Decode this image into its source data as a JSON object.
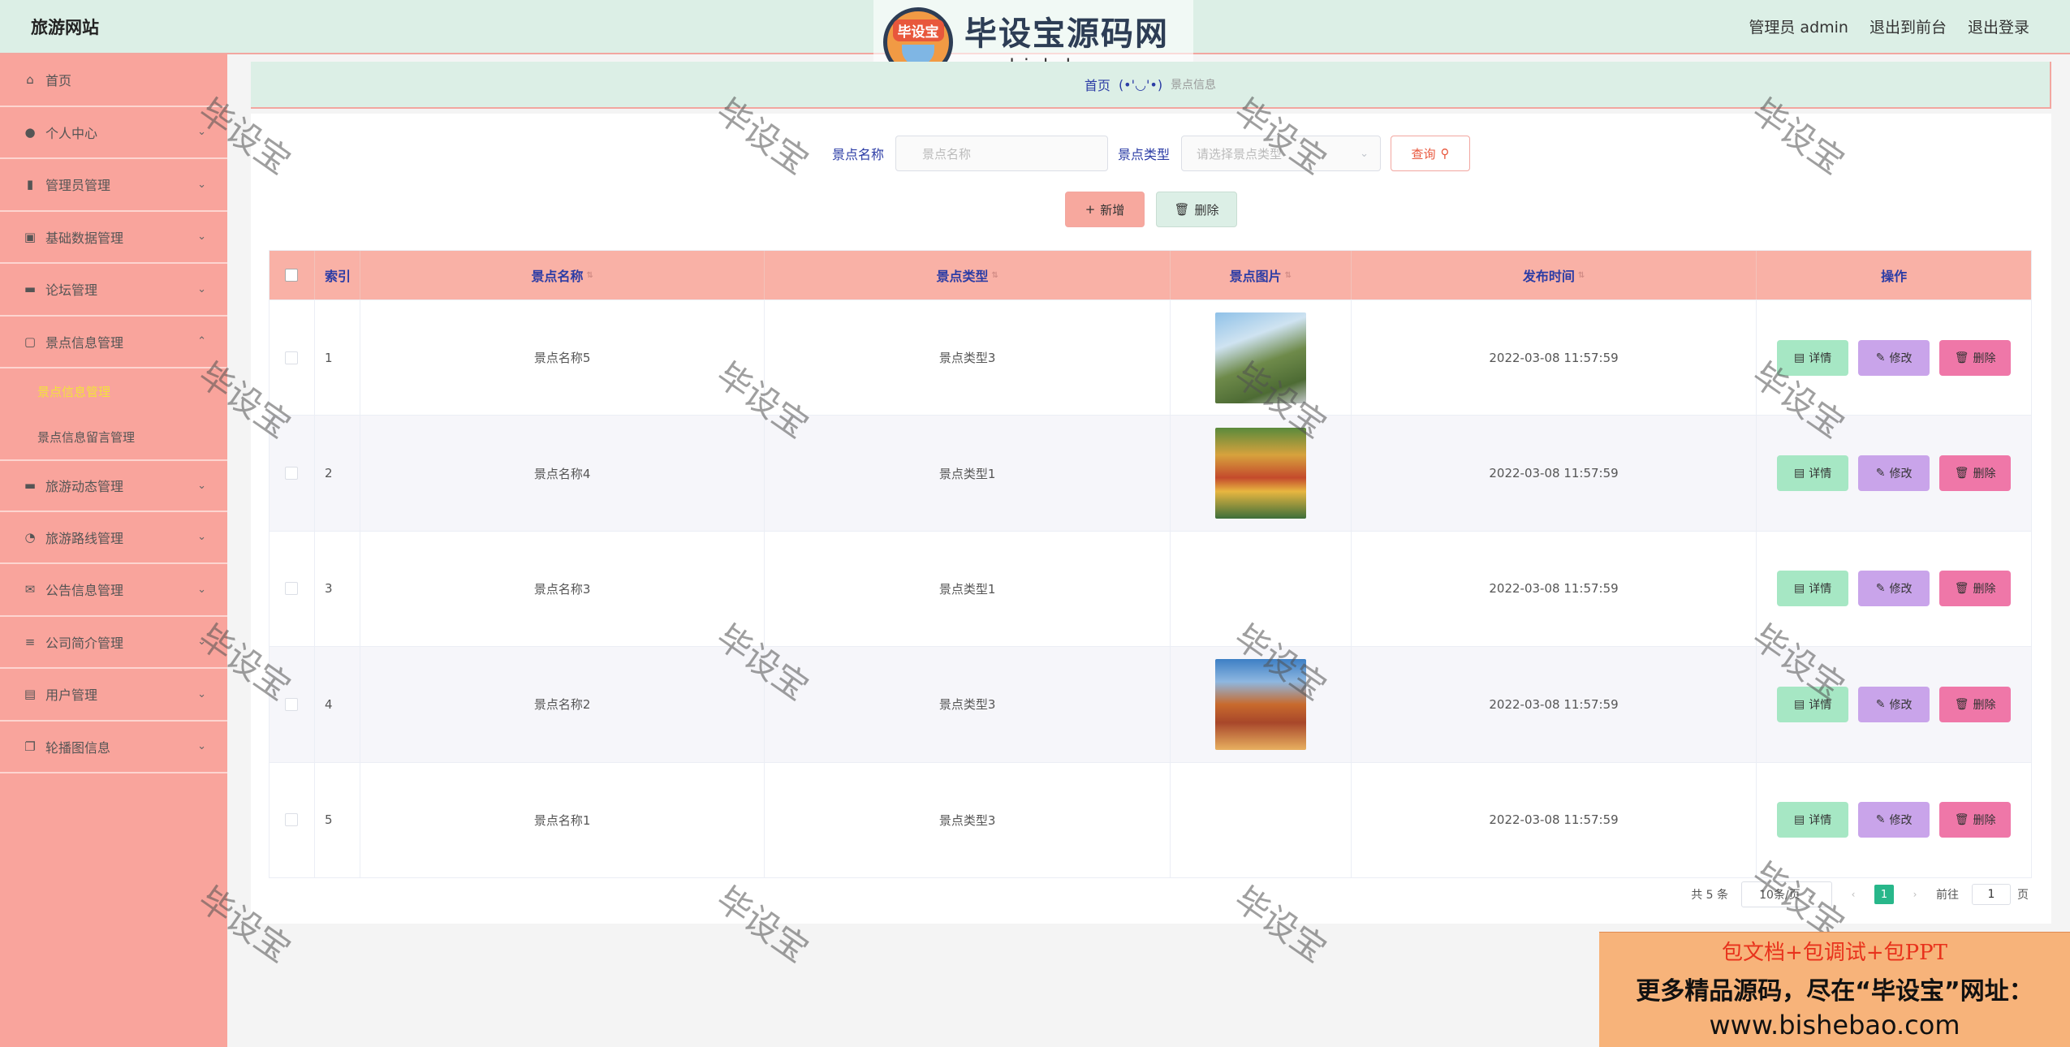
{
  "header": {
    "site_title": "旅游网站",
    "admin_label": "管理员 admin",
    "front_label": "退出到前台",
    "logout_label": "退出登录"
  },
  "logo": {
    "badge_text": "毕设宝",
    "name": "毕设宝源码网",
    "url": "www.bishebao.com"
  },
  "sidebar": {
    "items": [
      {
        "label": "首页",
        "icon": "home-icon"
      },
      {
        "label": "个人中心",
        "icon": "user-icon"
      },
      {
        "label": "管理员管理",
        "icon": "admin-icon"
      },
      {
        "label": "基础数据管理",
        "icon": "data-icon"
      },
      {
        "label": "论坛管理",
        "icon": "monitor-icon"
      },
      {
        "label": "景点信息管理",
        "icon": "chat-icon"
      },
      {
        "label": "旅游动态管理",
        "icon": "monitor-icon"
      },
      {
        "label": "旅游路线管理",
        "icon": "route-icon"
      },
      {
        "label": "公告信息管理",
        "icon": "mail-icon"
      },
      {
        "label": "公司简介管理",
        "icon": "menu-icon"
      },
      {
        "label": "用户管理",
        "icon": "clipboard-icon"
      },
      {
        "label": "轮播图信息",
        "icon": "copy-icon"
      }
    ],
    "sub_items": [
      {
        "label": "景点信息管理"
      },
      {
        "label": "景点信息留言管理"
      }
    ]
  },
  "breadcrumb": {
    "home": "首页",
    "face": "(•'◡'•)",
    "current": "景点信息"
  },
  "search": {
    "name_label": "景点名称",
    "name_placeholder": "景点名称",
    "type_label": "景点类型",
    "type_placeholder": "请选择景点类型",
    "query_label": "查询"
  },
  "actions": {
    "add_label": "新增",
    "delete_label": "删除"
  },
  "table": {
    "headers": {
      "index": "索引",
      "name": "景点名称",
      "type": "景点类型",
      "image": "景点图片",
      "time": "发布时间",
      "ops": "操作"
    },
    "rows": [
      {
        "index": "1",
        "name": "景点名称5",
        "type": "景点类型3",
        "time": "2022-03-08 11:57:59"
      },
      {
        "index": "2",
        "name": "景点名称4",
        "type": "景点类型1",
        "time": "2022-03-08 11:57:59"
      },
      {
        "index": "3",
        "name": "景点名称3",
        "type": "景点类型1",
        "time": "2022-03-08 11:57:59"
      },
      {
        "index": "4",
        "name": "景点名称2",
        "type": "景点类型3",
        "time": "2022-03-08 11:57:59"
      },
      {
        "index": "5",
        "name": "景点名称1",
        "type": "景点类型3",
        "time": "2022-03-08 11:57:59"
      }
    ],
    "op_labels": {
      "detail": "详情",
      "edit": "修改",
      "delete": "删除"
    }
  },
  "pagination": {
    "total": "共 5 条",
    "page_size": "10条/页",
    "current_page": "1",
    "goto_label": "前往",
    "goto_value": "1",
    "page_suffix": "页"
  },
  "watermark": "毕设宝",
  "ad": {
    "line1": "包文档+包调试+包PPT",
    "line2": "更多精品源码，尽在“毕设宝”网址：",
    "line3": "www.bishebao.com"
  },
  "colors": {
    "header_bg": "#dcefe6",
    "sidebar_bg": "#f9a49c",
    "table_head_bg": "#f9b1a6",
    "accent_text": "#2b3ca5",
    "page_active": "#28b78a"
  }
}
